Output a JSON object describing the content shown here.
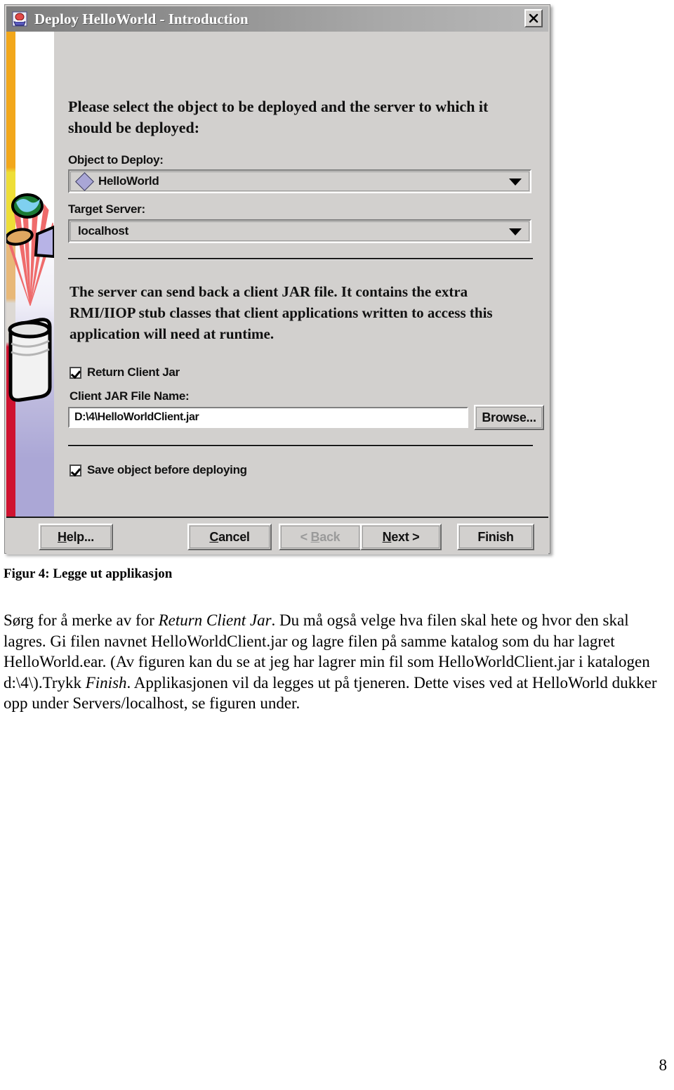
{
  "document": {
    "figure_caption": "Figur 4: Legge ut applikasjon",
    "paragraph_runs": [
      {
        "text": "Sørg for å merke av for ",
        "style": "normal"
      },
      {
        "text": "Return Client Jar",
        "style": "italic"
      },
      {
        "text": ". Du må også velge hva filen skal hete og hvor den skal lagres. Gi filen navnet HelloWorldClient.jar og lagre filen på samme katalog som du har lagret HelloWorld.ear. (Av figuren kan du se at jeg har lagrer min fil som HelloWorldClient.jar i katalogen  d:\\4\\).Trykk ",
        "style": "normal"
      },
      {
        "text": "Finish",
        "style": "italic"
      },
      {
        "text": ". Applikasjonen vil da legges ut på tjeneren. Dette vises ved at HelloWorld dukker opp under Servers/localhost, se figuren under.",
        "style": "normal"
      }
    ],
    "page_number": "8"
  },
  "dialog": {
    "titlebar": {
      "title": "Deploy HelloWorld - Introduction",
      "close_label": "×",
      "icon_name": "deploy-app-icon"
    },
    "intro_text": "Please select the object to be deployed and the server to which it should be deployed:",
    "object_to_deploy": {
      "label": "Object to Deploy:",
      "value": "HelloWorld",
      "icon_name": "diamond-object-icon"
    },
    "target_server": {
      "label": "Target Server:",
      "value": "localhost"
    },
    "client_jar_description": "The server can send back a client JAR file. It contains the extra RMI/IIOP stub classes that client applications written to access this application will need at runtime.",
    "return_client_jar": {
      "label": "Return Client Jar",
      "checked": true
    },
    "client_jar_file": {
      "label": "Client JAR File Name:",
      "value": "D:\\4\\HelloWorldClient.jar",
      "browse_label": "Browse..."
    },
    "save_object": {
      "label": "Save object before deploying",
      "checked": true
    },
    "buttons": {
      "help": {
        "pre": "H",
        "post": "elp...",
        "disabled": false
      },
      "cancel": {
        "pre": "C",
        "post": "ancel",
        "disabled": false
      },
      "back": {
        "lead": "< ",
        "pre": "B",
        "post": "ack",
        "disabled": true
      },
      "next": {
        "pre": "N",
        "post": "ext >",
        "disabled": false
      },
      "finish": {
        "label": "Finish",
        "disabled": false
      }
    }
  },
  "colors": {
    "dialog_face": "#d2d0ce",
    "titlebar_start": "#7e7e7e",
    "titlebar_end": "#b8b8b8",
    "stripe_orange": "#f2a71b",
    "stripe_yellow": "#eede37",
    "stripe_tan": "#e8b878",
    "stripe_red": "#cf1230",
    "banner_bottom": "#aba7d6",
    "object_icon": "#a9a6d6"
  }
}
